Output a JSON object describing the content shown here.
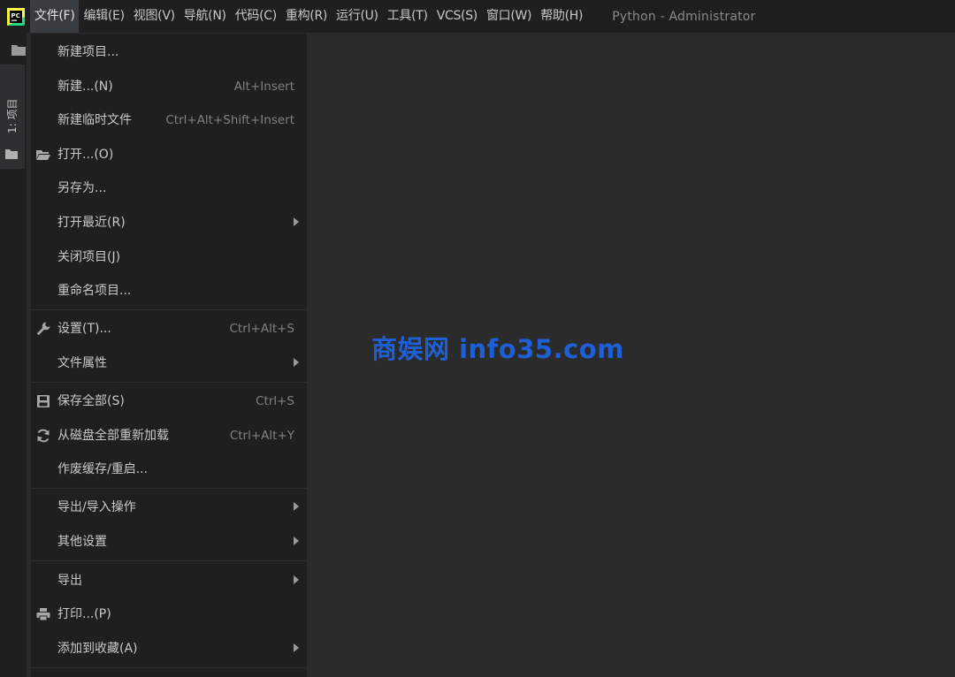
{
  "menubar": {
    "items": [
      "文件(F)",
      "编辑(E)",
      "视图(V)",
      "导航(N)",
      "代码(C)",
      "重构(R)",
      "运行(U)",
      "工具(T)",
      "VCS(S)",
      "窗口(W)",
      "帮助(H)"
    ],
    "window_title": "Python - Administrator"
  },
  "toolstrip": {
    "project_tab_label": "1: 项目"
  },
  "file_menu": {
    "new_project": "新建项目...",
    "new": "新建...(N)",
    "new_shortcut": "Alt+Insert",
    "new_scratch": "新建临时文件",
    "new_scratch_shortcut": "Ctrl+Alt+Shift+Insert",
    "open": "打开...(O)",
    "save_as": "另存为...",
    "open_recent": "打开最近(R)",
    "close_project": "关闭项目(J)",
    "rename_project": "重命名项目...",
    "settings": "设置(T)...",
    "settings_shortcut": "Ctrl+Alt+S",
    "file_properties": "文件属性",
    "save_all": "保存全部(S)",
    "save_all_shortcut": "Ctrl+S",
    "reload_all": "从磁盘全部重新加载",
    "reload_all_shortcut": "Ctrl+Alt+Y",
    "invalidate_caches": "作废缓存/重启...",
    "export_import": "导出/导入操作",
    "other_settings": "其他设置",
    "export": "导出",
    "print": "打印...(P)",
    "add_to_favorites": "添加到收藏(A)"
  },
  "watermark": "商娱网 info35.com",
  "colors": {
    "menu_bg": "#1f1f1f",
    "editor_bg": "#2b2b2b",
    "watermark": "#1f5fd6"
  }
}
